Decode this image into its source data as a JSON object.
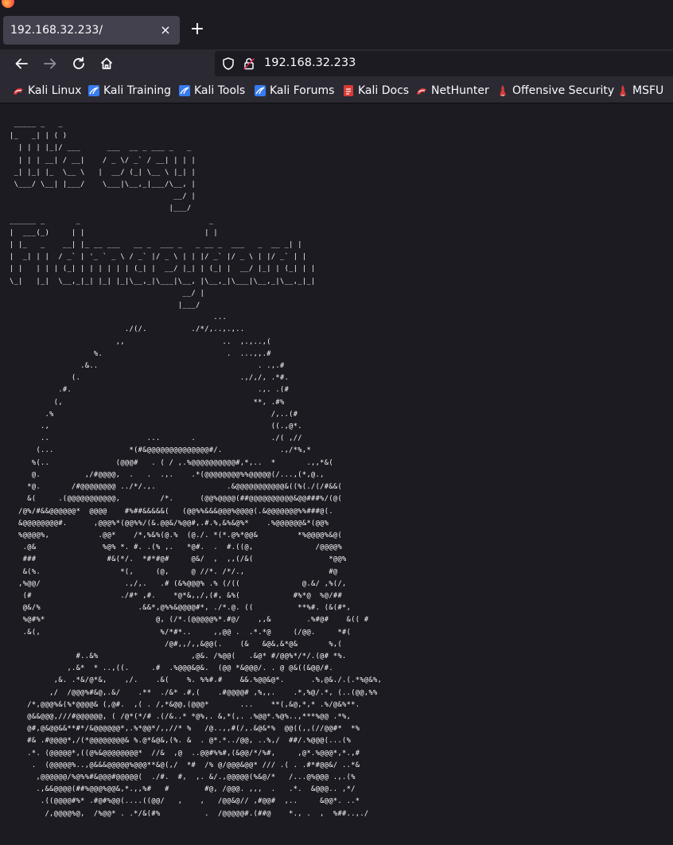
{
  "browser": {
    "tab_title": "192.168.32.233/",
    "tab_close_glyph": "×",
    "new_tab_glyph": "+",
    "url": "192.168.32.233"
  },
  "nav": {
    "back_icon": "arrow-left-icon",
    "forward_icon": "arrow-right-icon",
    "reload_icon": "reload-icon",
    "home_icon": "home-icon"
  },
  "bookmarks": [
    {
      "label": "Kali Linux",
      "icon": "kali-dragon-icon",
      "color": "#e03a3e"
    },
    {
      "label": "Kali Training",
      "icon": "kali-training-icon",
      "color": "#367bf0"
    },
    {
      "label": "Kali Tools",
      "icon": "kali-tools-icon",
      "color": "#367bf0"
    },
    {
      "label": "Kali Forums",
      "icon": "kali-forums-icon",
      "color": "#367bf0"
    },
    {
      "label": "Kali Docs",
      "icon": "kali-docs-icon",
      "color": "#d93a35"
    },
    {
      "label": "NetHunter",
      "icon": "nethunter-icon",
      "color": "#e03a3e"
    },
    {
      "label": "Offensive Security",
      "icon": "offsec-icon",
      "color": "#d93a35"
    },
    {
      "label": "MSFU",
      "icon": "msfu-icon",
      "color": "#d93a35"
    }
  ],
  "page": {
    "ascii_art": " _____ _   _\n|_   _| | ( )\n  | | | |_|/ ___      ___  __ _ ___ _   _\n  | | | __| / __|    / _ \\/ _` / __| | | |\n _| |_| |_  \\__ \\   |  __/ (_| \\__ \\ |_| |\n \\___/ \\__| |___/    \\___|\\__,_|___/\\__, |\n                                     __/ |\n                                    |___/\n______ _       _                             _\n|  ___(_)     | |                           | |\n| |_   _    __| |_ __ ___   __ _  ___ _   _ __ _  ___   _  __ _| |\n|  _| | |  / _` | '_ ` _ \\ / _` |/ _ \\ | | |/ _` |/ _ \\ | |/ _` | |\n| |   | | | (_| | | | | | | (_| |  __/ |_| | (_| |  __/ |_| | (_| | |\n\\_|   |_|  \\__,_|_| |_| |_|\\__,_|\\___|\\__, |\\__,_|\\___|\\__,_|\\__,_|_|\n                                       __/ |\n                                      |___/\n                                              ...\n                          ./(/.          ./*/,..,.,..\n                        ,,                      ..  ,.,..,(\n                   %.                            .  ...,,.#\n                .&..                                    . .,.#\n              (.                                    .,/,/, .*#.\n           .#.                                          .,. .(#\n          (,                                           **, .#%\n        .%                                                 /,..(#\n       .,                                                  ((.,@*.\n       ..                      ...       .                 ./( ,//\n      (...                 *(#&@@@@@@@@@@@@@@#/.             .,/*%,*\n     %(..               (@@@#   . ( / ,.%@@@@@@@@@@#,*,..  *       .,,*&(\n     @.          ,/#@@@@,  .   .  .,.    .*(@@@@@@@@%%@@@@@(/...,(*,@.,\n    *@.       /#@@@@@@@@ ../*/.,.                .&@@@@@@@@@@@&((%(./(/#&&(\n    &(     .(@@@@@@@@@@@,         /*.      (@@%@@@@(##@@@@@@@@@@&@@###%/(@(\n  /@%/#&&@@@@@@*  @@@@    #%##&&&&&(   (@@%%&&&@@@%@@@@(.&@@@@@@@%%###@(.\n  &@@@@@@@@#.      ,@@@%*(@@%%/(&.@@&/%@@#,.#.%,&%&@%*    .%@@@@@@&*(@@%\n  %@@@@%,           .@@*    /*,%&%(@.%  (@./. *(*.@%*@@&         *%@@@@%&@(\n   .@&               %@% *. #. .(% ,.   *@#.  .  #.((@,              /@@@@%\n   ###                #&(*/.  *#*#@#     @&/  ,  ,,(/&(                 *@@%\n   &(%.                  *(,     (@,     @ //*. /*/.,                   #@\n  ,%@@/                   .,/,.   .# (&%@@@% .% (/((              @.&/ ,%(/,\n   (#                    ./#* ,#.    *@*&,,/,(#, &%(            #%*@  %@/##\n   @&/%                      .&&*,@%%&@@@@#*, ./*.@. ((          **%#. (&(#*,\n   %@#%*                         @, (/*.(@@@@@%*.#@/    ,,&        .%#@#    &(( #\n   .&(,                           %/*#*..     ,,@@ .  .*.*@     (/@@.     *#(\n                                   /@#,,/,,&@@(.    (&   &@&,&*@&       %,(\n               #..&%                     ,@&. /%@@(   .&@* #/@@%*/*/.(@# *%.\n             ,.&*  * ..,((.     .#  .%@@@&@&.  (@@ *&@@@/. . @ @&((&@@/#.\n          ,&. .*&/@*&,    ,/.    .&(    %. %%#.#    &&.%@@&@*.      .%,@&./.(.*%@&%,\n         ,/  /@@@%#&@,.&/    .**  ./&* .#,(    .#@@@@# ,%,,.    .*,%@/.*, (..(@@,%%\n    /*,@@@%&(%*@@@@& (,@#.  ,( . /,*&@@,(@@@*       ...    **(,&@,*,* .%/@&%**.\n    @&&@@@,///#@@@@@@, ( /@*(*/# .(/&..* *@%,. &,*(,. .%@@*.%@%..,***%@@ .*%,\n    @#,@&@@&&**#*/&@@@@@@*,.%*@@*/,,//* %   /@..,,#(/,.&@&*%  @@((,,(//@@#*  *%\n    #& .#@@@@*,/(*@@@@@@@@& %.@*&@&,(%. &  . @*.*../@@, ..%,/  ##/.%@@@(...(%\n    .*. (@@@@@*,((@%&@@@@@@@@*  //&  ,@  ..@@#%%#,(&@@/*/%#,     ,@*.%@@@*,*.,#\n     .  (@@@@@%..,@&&&@@@@@%@@@**&@(,/  *#  /% @/@@@&@@* /// .( . .#*#@@&/ ..*&\n      ,@@@@@@/%@%%#&@@@#@@@@@(  ./#.  #,  ,. &/.,@@@@@(%&@/*   /...@%@@@ .,.(%\n      .,&&@@@@(##%@@@%@@&,*.,,%#   #        #@, /@@@. ,,,  .   .*.  &@@@.. ,*/\n       .((@@@@#%* .#@#%@@(....((@@/   ,    ,   /@@&@// ,#@@#  ,..     &@@*. ..*\n        /,@@@@%@,  /%@@* . .*/&(#%          .  /@@@@@#.(##@    *., .  ,  %##..,./"
  }
}
